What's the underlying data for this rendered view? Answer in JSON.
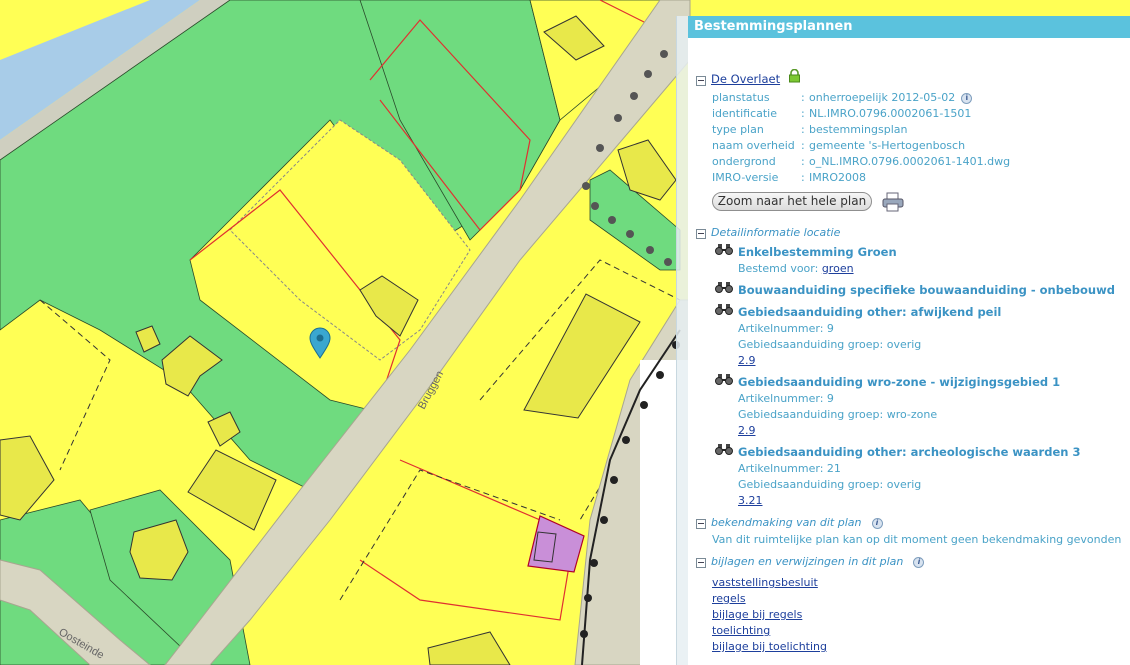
{
  "panel": {
    "title": "Bestemmingsplannen",
    "plan_name": "De Overlaet",
    "lock_icon": "lock-icon",
    "fields": [
      {
        "label": "planstatus",
        "sep": ":",
        "value": "onherroepelijk 2012-05-02",
        "has_info": true
      },
      {
        "label": "identificatie",
        "sep": ":",
        "value": "NL.IMRO.0796.0002061-1501",
        "has_info": false
      },
      {
        "label": "type plan",
        "sep": ":",
        "value": "bestemmingsplan",
        "has_info": false
      },
      {
        "label": "naam overheid",
        "sep": ":",
        "value": "gemeente 's-Hertogenbosch",
        "has_info": false
      },
      {
        "label": "ondergrond",
        "sep": ":",
        "value": "o_NL.IMRO.0796.0002061-1401.dwg",
        "has_info": false
      },
      {
        "label": "IMRO-versie",
        "sep": ":",
        "value": "IMRO2008",
        "has_info": false
      }
    ],
    "zoom_button": "Zoom naar het hele plan",
    "print_icon": "printer-icon",
    "detail_section": "Detailinformatie locatie",
    "items": [
      {
        "title": "Enkelbestemming Groen",
        "line1_prefix": "Bestemd voor: ",
        "line1_link": "groen"
      },
      {
        "title": "Bouwaanduiding specifieke bouwaanduiding - onbebouwd"
      },
      {
        "title": "Gebiedsaanduiding other: afwijkend peil",
        "line1": "Artikelnummer: 9",
        "line2": "Gebiedsaanduiding groep: overig",
        "link": "2.9"
      },
      {
        "title": "Gebiedsaanduiding wro-zone - wijzigingsgebied 1",
        "line1": "Artikelnummer: 9",
        "line2": "Gebiedsaanduiding groep: wro-zone",
        "link": "2.9"
      },
      {
        "title": "Gebiedsaanduiding other: archeologische waarden 3",
        "line1": "Artikelnummer: 21",
        "line2": "Gebiedsaanduiding groep: overig",
        "link": "3.21"
      }
    ],
    "bekendmaking_section": "bekendmaking van dit plan",
    "bekendmaking_text": "Van dit ruimtelijke plan kan op dit moment geen bekendmaking gevonden",
    "bijlagen_section": "bijlagen en verwijzingen in dit plan",
    "documents": [
      "vaststellingsbesluit",
      "regels",
      "bijlage bij regels",
      "toelichting",
      "bijlage bij toelichting"
    ]
  },
  "map": {
    "street_labels": [
      "Bruggen",
      "Oosteinde"
    ],
    "colors": {
      "green": "#6fdb7f",
      "yellow": "#ffff55",
      "road": "#d8d6c2",
      "water": "#a8cce8",
      "purple": "#c98fd8",
      "marker": "#3aa7d0",
      "panel_header": "#5bc2dd"
    }
  }
}
